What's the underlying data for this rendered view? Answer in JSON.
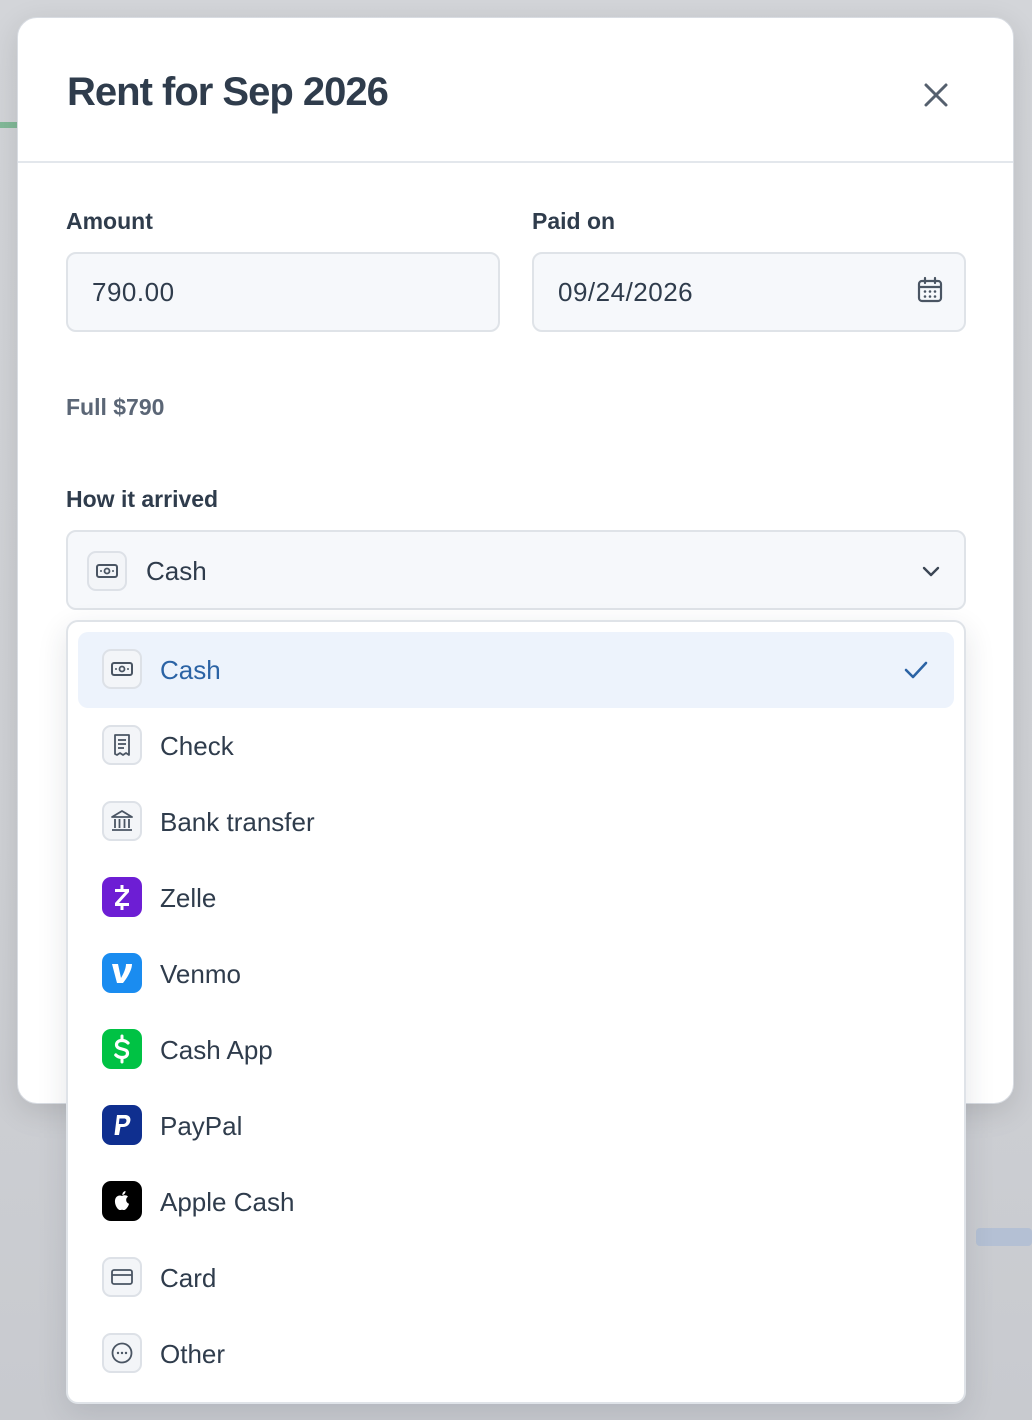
{
  "modal": {
    "title": "Rent for Sep 2026"
  },
  "form": {
    "amount_label": "Amount",
    "amount_value": "790.00",
    "paid_on_label": "Paid on",
    "paid_on_value": "09/24/2026",
    "hint": "Full $790",
    "method_label": "How it arrived",
    "method_selected": "Cash"
  },
  "dropdown": {
    "options": [
      {
        "label": "Cash",
        "icon": "cash-icon",
        "selected": true
      },
      {
        "label": "Check",
        "icon": "check-receipt-icon",
        "selected": false
      },
      {
        "label": "Bank transfer",
        "icon": "bank-icon",
        "selected": false
      },
      {
        "label": "Zelle",
        "icon": "zelle-icon",
        "color": "#6d1ed4",
        "selected": false
      },
      {
        "label": "Venmo",
        "icon": "venmo-icon",
        "color": "#1a8cf0",
        "selected": false
      },
      {
        "label": "Cash App",
        "icon": "cash-app-icon",
        "color": "#00c244",
        "selected": false
      },
      {
        "label": "PayPal",
        "icon": "paypal-icon",
        "color": "#0f2f8f",
        "selected": false
      },
      {
        "label": "Apple Cash",
        "icon": "apple-icon",
        "color": "#000000",
        "selected": false
      },
      {
        "label": "Card",
        "icon": "card-icon",
        "selected": false
      },
      {
        "label": "Other",
        "icon": "more-icon",
        "selected": false
      }
    ]
  },
  "colors": {
    "accent": "#2b63a5",
    "selected_bg": "#edf3fc",
    "text": "#2f3c4c"
  }
}
